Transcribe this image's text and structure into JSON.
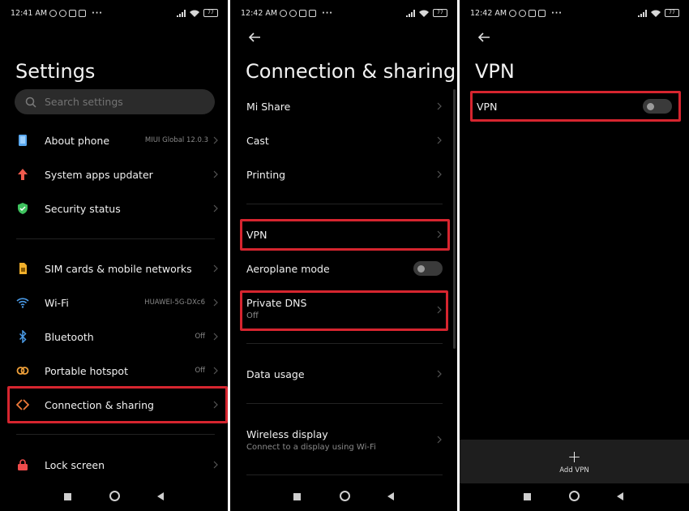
{
  "status_left": [
    "12:41 AM",
    "12:42 AM",
    "12:42 AM"
  ],
  "battery": "77",
  "settings": {
    "title": "Settings",
    "search_placeholder": "Search settings",
    "items": [
      {
        "label": "About phone",
        "value": "MIUI Global 12.0.3",
        "icon": "phone-icon",
        "color": "#5aa8ee"
      },
      {
        "label": "System apps updater",
        "value": "",
        "icon": "arrow-up-icon",
        "color": "#ef5a4d"
      },
      {
        "label": "Security status",
        "value": "",
        "icon": "shield-icon",
        "color": "#3ec25e"
      },
      {
        "label": "SIM cards & mobile networks",
        "value": "",
        "icon": "sim-icon",
        "color": "#f2b02b"
      },
      {
        "label": "Wi-Fi",
        "value": "HUAWEI-5G-DXc6",
        "icon": "wifi-icon",
        "color": "#4a9ae6"
      },
      {
        "label": "Bluetooth",
        "value": "Off",
        "icon": "bluetooth-icon",
        "color": "#4a9ae6"
      },
      {
        "label": "Portable hotspot",
        "value": "Off",
        "icon": "hotspot-icon",
        "color": "#f0a13a"
      },
      {
        "label": "Connection & sharing",
        "value": "",
        "icon": "connection-icon",
        "color": "#f07a3a"
      },
      {
        "label": "Lock screen",
        "value": "",
        "icon": "lock-icon",
        "color": "#ef4b4b"
      }
    ]
  },
  "connection": {
    "title": "Connection & sharing",
    "items": [
      {
        "label": "Mi Share",
        "sub": ""
      },
      {
        "label": "Cast",
        "sub": ""
      },
      {
        "label": "Printing",
        "sub": ""
      },
      {
        "label": "VPN",
        "sub": ""
      },
      {
        "label": "Aeroplane mode",
        "sub": ""
      },
      {
        "label": "Private DNS",
        "sub": "Off"
      },
      {
        "label": "Data usage",
        "sub": ""
      },
      {
        "label": "Wireless display",
        "sub": "Connect to a display using Wi-Fi"
      }
    ]
  },
  "vpn": {
    "title": "VPN",
    "toggle_label": "VPN",
    "toggle_on": false,
    "add_label": "Add VPN",
    "add_symbol": "+"
  },
  "colors": {
    "highlight": "#d6252f",
    "background": "#000000"
  }
}
